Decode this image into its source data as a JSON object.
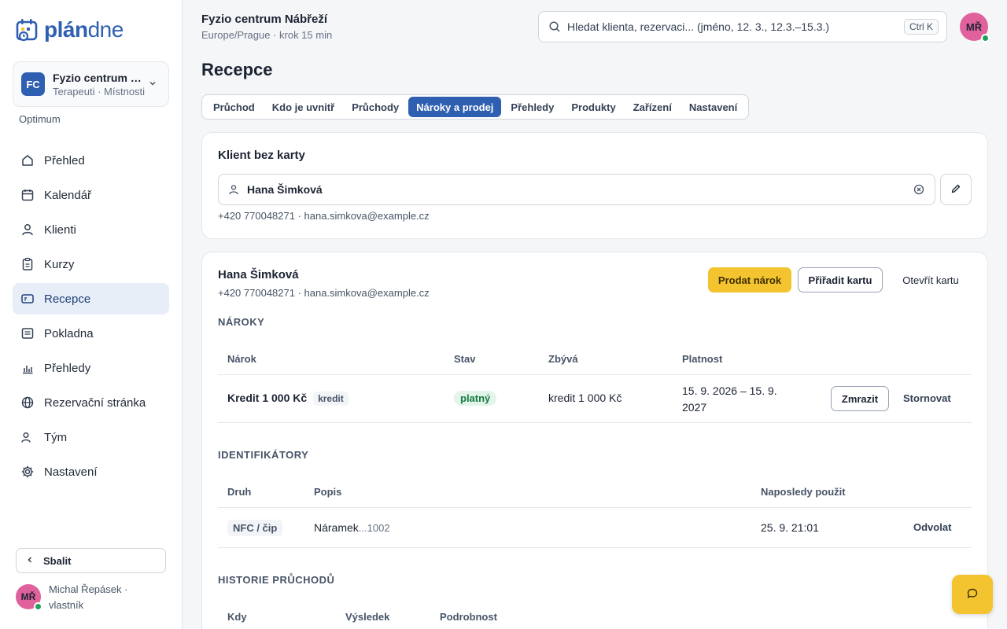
{
  "brand": {
    "logo_a": "plán",
    "logo_b": "dne"
  },
  "org": {
    "initials": "FC",
    "name": "Fyzio centrum Nábřeží",
    "sub": "Terapeuti · Místnosti",
    "plan": "Optimum"
  },
  "nav": [
    {
      "label": "Přehled",
      "icon": "home-icon"
    },
    {
      "label": "Kalendář",
      "icon": "calendar-icon"
    },
    {
      "label": "Klienti",
      "icon": "user-icon"
    },
    {
      "label": "Kurzy",
      "icon": "clipboard-icon"
    },
    {
      "label": "Recepce",
      "icon": "card-icon"
    },
    {
      "label": "Pokladna",
      "icon": "register-icon"
    },
    {
      "label": "Přehledy",
      "icon": "bar-chart-icon"
    },
    {
      "label": "Rezervační stránka",
      "icon": "globe-icon"
    },
    {
      "label": "Tým",
      "icon": "team-icon"
    },
    {
      "label": "Nastavení",
      "icon": "gear-icon"
    }
  ],
  "sidebar": {
    "collapse_label": "Sbalit",
    "user_initials": "MŘ",
    "user_name": "Michal Řepásek · vlastník"
  },
  "topbar": {
    "title": "Fyzio centrum Nábřeží",
    "sub": "Europe/Prague · krok 15 min",
    "search_placeholder": "Hledat klienta, rezervaci... (jméno, 12. 3., 12.3.–15.3.)",
    "shortcut": "Ctrl K",
    "avatar": "MŘ"
  },
  "page": {
    "title": "Recepce"
  },
  "tabs": [
    "Průchod",
    "Kdo je uvnitř",
    "Průchody",
    "Nároky a prodej",
    "Přehledy",
    "Produkty",
    "Zařízení",
    "Nastavení"
  ],
  "client_card": {
    "title": "Klient bez karty",
    "client_value": "Hana Šimková",
    "contact": "+420 770048271 · hana.simkova@example.cz"
  },
  "client_detail": {
    "name": "Hana Šimková",
    "contact": "+420 770048271 · hana.simkova@example.cz",
    "sell_label": "Prodat nárok",
    "assign_label": "Přiřadit kartu",
    "open_label": "Otevřít kartu"
  },
  "entitlements": {
    "section": "NÁROKY",
    "headers": [
      "Nárok",
      "Stav",
      "Zbývá",
      "Platnost"
    ],
    "rows": [
      {
        "name": "Kredit 1 000 Kč",
        "type": "kredit",
        "status": "platný",
        "remaining": "kredit 1 000 Kč",
        "validity_a": "15. 9. 2026 – 15. 9.",
        "validity_b": "2027",
        "freeze": "Zmrazit",
        "cancel": "Stornovat"
      }
    ]
  },
  "identifiers": {
    "section": "IDENTIFIKÁTORY",
    "headers": [
      "Druh",
      "Popis",
      "Naposledy použit"
    ],
    "rows": [
      {
        "kind": "NFC / čip",
        "desc": "Náramek",
        "desc_id": "...1002",
        "last_used": "25. 9. 21:01",
        "action": "Odvolat"
      }
    ]
  },
  "history": {
    "section": "HISTORIE PRŮCHODŮ",
    "headers": [
      "Kdy",
      "Výsledek",
      "Podrobnost"
    ]
  },
  "colors": {
    "accent": "#2f5fb0",
    "primary_button": "#f4c430",
    "status_ok": "#22a05b",
    "avatar": "#e0619b"
  }
}
